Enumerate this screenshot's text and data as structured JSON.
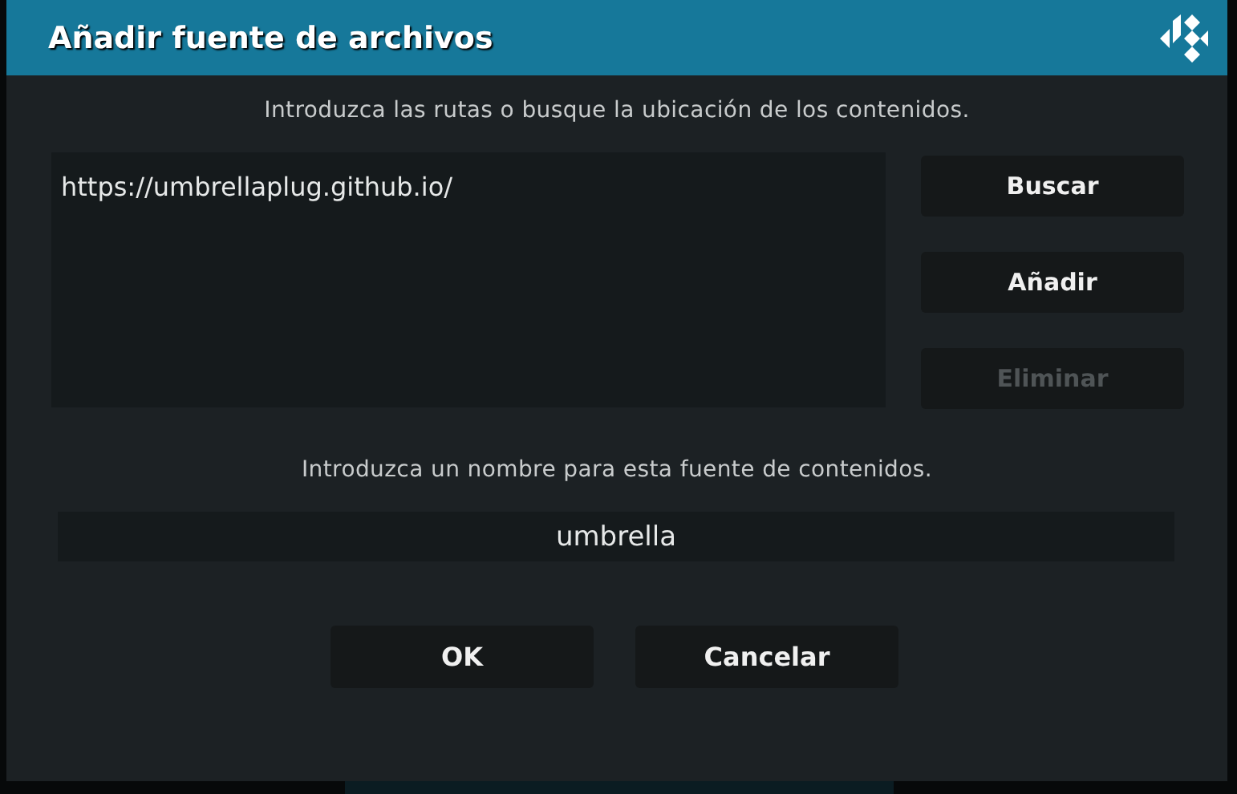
{
  "window": {
    "title": "Añadir fuente de archivos"
  },
  "paths_prompt": "Introduzca las rutas o busque la ubicación de los contenidos.",
  "paths": [
    "https://umbrellaplug.github.io/"
  ],
  "side_buttons": [
    {
      "label": "Buscar",
      "disabled": false
    },
    {
      "label": "Añadir",
      "disabled": false
    },
    {
      "label": "Eliminar",
      "disabled": true
    }
  ],
  "name_prompt": "Introduzca un nombre para esta fuente de contenidos.",
  "name_field": {
    "value": "umbrella"
  },
  "buttons": [
    "OK",
    "Cancelar"
  ]
}
